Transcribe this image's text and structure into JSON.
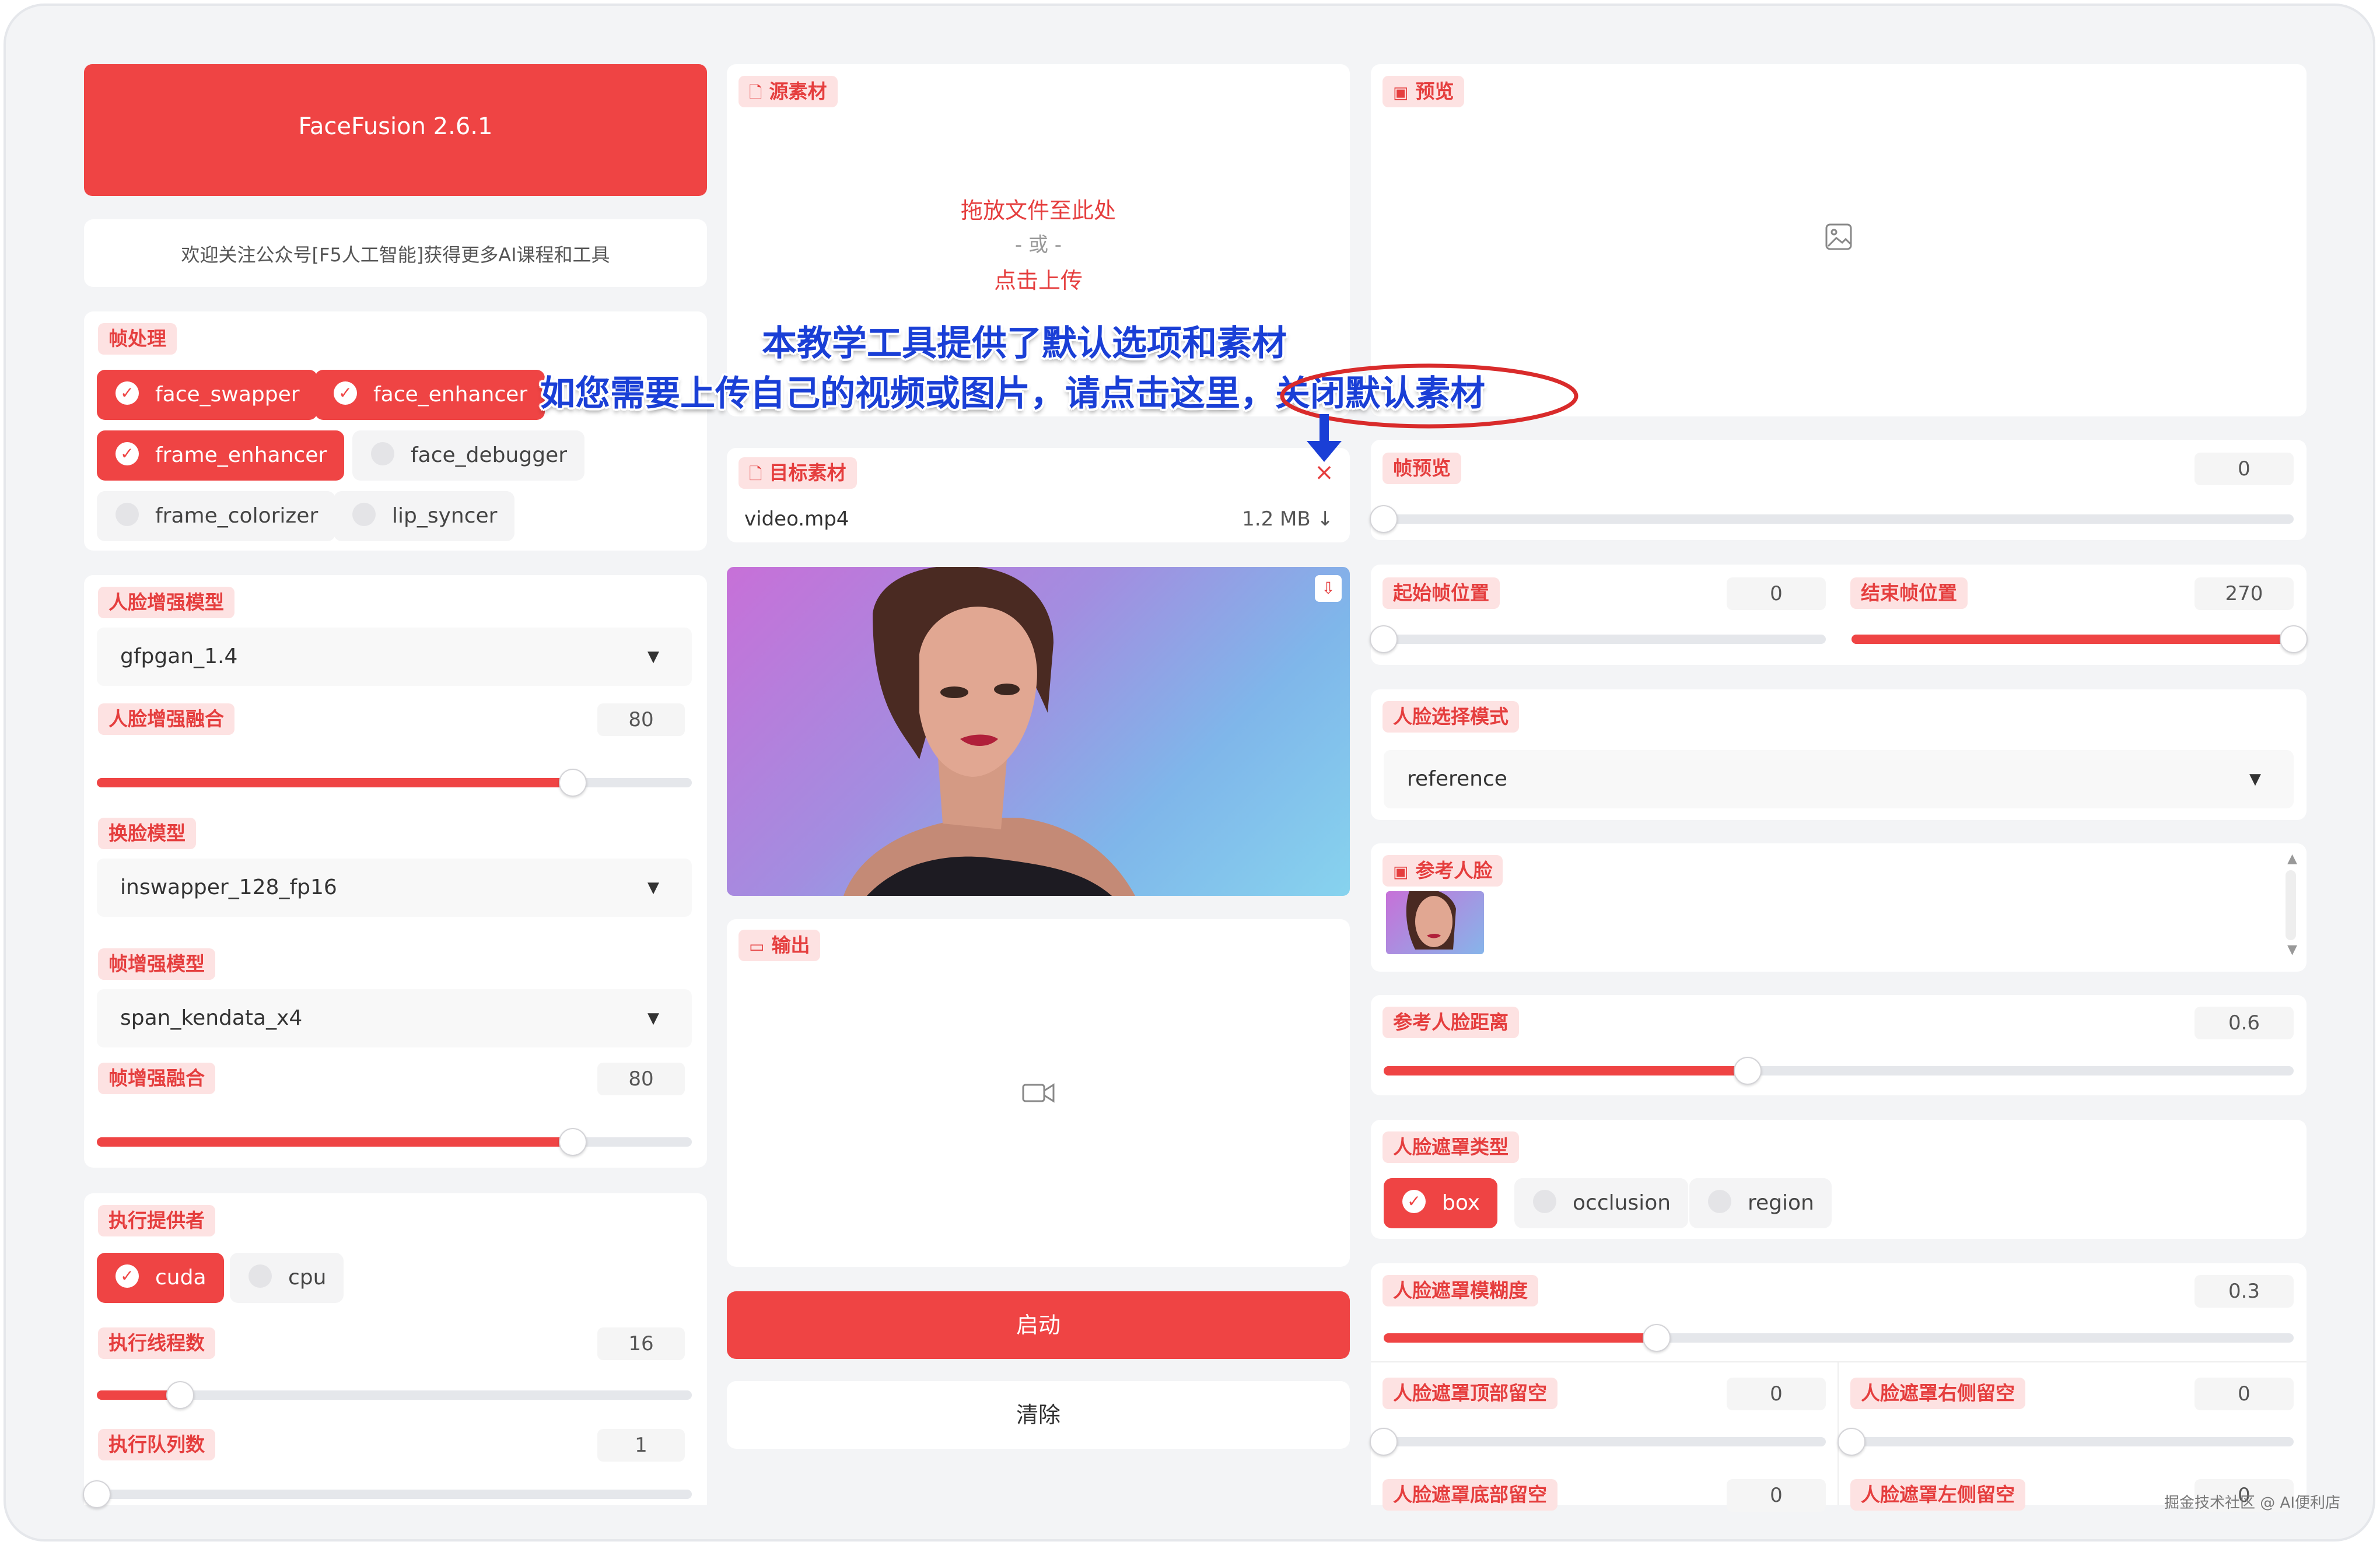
{
  "app": {
    "title": "FaceFusion 2.6.1",
    "notice": "欢迎关注公众号[F5人工智能]获得更多AI课程和工具"
  },
  "frame_processors": {
    "label": "帧处理",
    "options": [
      {
        "label": "face_swapper",
        "checked": true
      },
      {
        "label": "face_enhancer",
        "checked": true
      },
      {
        "label": "frame_enhancer",
        "checked": true
      },
      {
        "label": "face_debugger",
        "checked": false
      },
      {
        "label": "frame_colorizer",
        "checked": false
      },
      {
        "label": "lip_syncer",
        "checked": false
      }
    ]
  },
  "face_enhancer": {
    "model_label": "人脸增强模型",
    "model_value": "gfpgan_1.4",
    "blend_label": "人脸增强融合",
    "blend_value": "80",
    "blend_fraction": 0.8
  },
  "face_swapper": {
    "model_label": "换脸模型",
    "model_value": "inswapper_128_fp16"
  },
  "frame_enhancer": {
    "model_label": "帧增强模型",
    "model_value": "span_kendata_x4",
    "blend_label": "帧增强融合",
    "blend_value": "80",
    "blend_fraction": 0.8
  },
  "execution": {
    "providers_label": "执行提供者",
    "providers": [
      {
        "label": "cuda",
        "checked": true
      },
      {
        "label": "cpu",
        "checked": false
      }
    ],
    "threads_label": "执行线程数",
    "threads_value": "16",
    "threads_fraction": 0.14,
    "queue_label": "执行队列数",
    "queue_value": "1",
    "queue_fraction": 0.0
  },
  "source": {
    "label": "源素材",
    "drop_text": "拖放文件至此处",
    "or_text": "- 或 -",
    "click_text": "点击上传"
  },
  "target": {
    "label": "目标素材",
    "file_name": "video.mp4",
    "file_size": "1.2 MB ↓",
    "close_glyph": "×"
  },
  "output": {
    "label": "输出"
  },
  "actions": {
    "start_label": "启动",
    "clear_label": "清除"
  },
  "preview": {
    "label": "预览",
    "frame_label": "帧预览",
    "frame_value": "0",
    "frame_fraction": 0.0
  },
  "trim": {
    "start_label": "起始帧位置",
    "start_value": "0",
    "start_fraction": 0.0,
    "end_label": "结束帧位置",
    "end_value": "270",
    "end_fraction": 1.0
  },
  "face_selector": {
    "mode_label": "人脸选择模式",
    "mode_value": "reference",
    "reference_label": "参考人脸",
    "distance_label": "参考人脸距离",
    "distance_value": "0.6",
    "distance_fraction": 0.4
  },
  "face_mask": {
    "types_label": "人脸遮罩类型",
    "types": [
      {
        "label": "box",
        "checked": true
      },
      {
        "label": "occlusion",
        "checked": false
      },
      {
        "label": "region",
        "checked": false
      }
    ],
    "blur_label": "人脸遮罩模糊度",
    "blur_value": "0.3",
    "blur_fraction": 0.3,
    "padding_top_label": "人脸遮罩顶部留空",
    "padding_top_value": "0",
    "padding_right_label": "人脸遮罩右侧留空",
    "padding_right_value": "0",
    "padding_bottom_label": "人脸遮罩底部留空",
    "padding_bottom_value": "0",
    "padding_left_label": "人脸遮罩左侧留空",
    "padding_left_value": "0"
  },
  "annotation": {
    "line1": "本教学工具提供了默认选项和素材",
    "line2": "如您需要上传自己的视频或图片，请点击这里，关闭默认素材",
    "color": "#1a3fd6",
    "circle_color": "#d92b2b"
  },
  "watermark": "掘金技术社区 @ AI便利店",
  "colors": {
    "accent": "#ef4444",
    "tag_bg": "#fde2e2",
    "page_bg": "#f3f4f6"
  }
}
